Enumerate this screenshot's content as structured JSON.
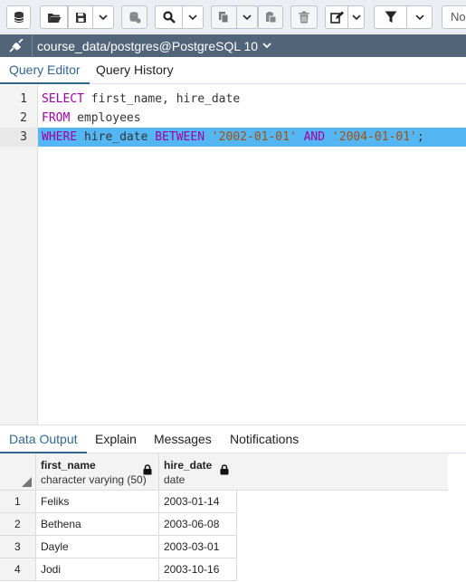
{
  "toolbar": {
    "truncated_label": "No",
    "buttons": [
      "database-icon",
      "open-folder-icon",
      "save-icon",
      "chevron-down-icon",
      "clear-icon",
      "search-icon",
      "chevron-down-icon",
      "copy-icon",
      "chevron-down-icon",
      "paste-icon",
      "delete-icon",
      "edit-icon",
      "chevron-down-icon",
      "filter-icon",
      "chevron-down-icon"
    ]
  },
  "connection": {
    "label": "course_data/postgres@PostgreSQL 10"
  },
  "query_tabs": [
    {
      "label": "Query Editor",
      "active": true
    },
    {
      "label": "Query History",
      "active": false
    }
  ],
  "editor": {
    "lines": [
      {
        "num": "1",
        "tokens": [
          {
            "t": "SELECT",
            "c": "kw"
          },
          {
            "t": " first_name, hire_date",
            "c": ""
          }
        ]
      },
      {
        "num": "2",
        "tokens": [
          {
            "t": "FROM",
            "c": "kw"
          },
          {
            "t": " employees",
            "c": ""
          }
        ]
      },
      {
        "num": "3",
        "tokens": [
          {
            "t": "WHERE",
            "c": "kw"
          },
          {
            "t": " hire_date ",
            "c": ""
          },
          {
            "t": "BETWEEN",
            "c": "kw"
          },
          {
            "t": " ",
            "c": ""
          },
          {
            "t": "'2002-01-01'",
            "c": "str"
          },
          {
            "t": " ",
            "c": ""
          },
          {
            "t": "AND",
            "c": "kw"
          },
          {
            "t": " ",
            "c": ""
          },
          {
            "t": "'2004-01-01'",
            "c": "str"
          },
          {
            "t": ";",
            "c": ""
          }
        ],
        "highlighted": true
      }
    ]
  },
  "result_tabs": [
    {
      "label": "Data Output",
      "active": true
    },
    {
      "label": "Explain",
      "active": false
    },
    {
      "label": "Messages",
      "active": false
    },
    {
      "label": "Notifications",
      "active": false
    }
  ],
  "grid": {
    "columns": [
      {
        "name": "first_name",
        "type": "character varying (50)"
      },
      {
        "name": "hire_date",
        "type": "date"
      }
    ],
    "rows": [
      {
        "num": "1",
        "cells": [
          "Feliks",
          "2003-01-14"
        ]
      },
      {
        "num": "2",
        "cells": [
          "Bethena",
          "2003-06-08"
        ]
      },
      {
        "num": "3",
        "cells": [
          "Dayle",
          "2003-03-01"
        ]
      },
      {
        "num": "4",
        "cells": [
          "Jodi",
          "2003-10-16"
        ]
      }
    ]
  },
  "colors": {
    "accent": "#326690",
    "connection_bar": "#526479",
    "line_highlight": "#55b6f4",
    "keyword": "#a000a0",
    "string": "#a35010"
  }
}
